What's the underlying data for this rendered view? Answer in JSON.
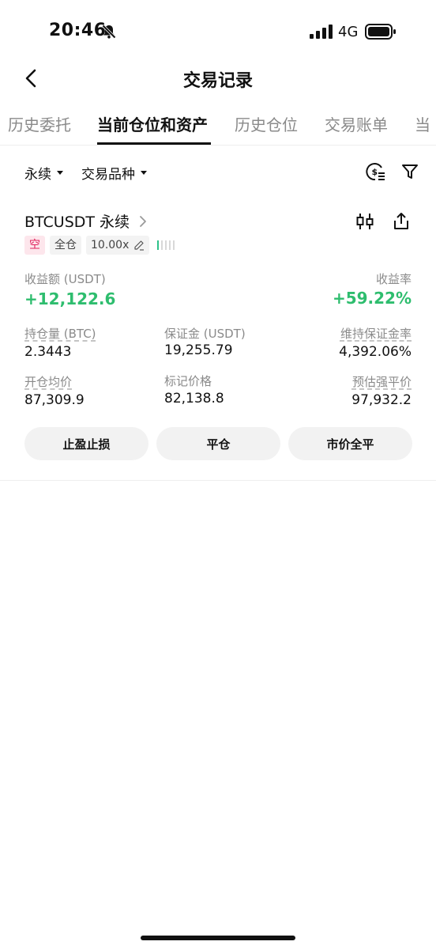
{
  "status_bar": {
    "time": "20:46",
    "network": "4G"
  },
  "nav": {
    "title": "交易记录"
  },
  "tabs": [
    {
      "label": "历史委托"
    },
    {
      "label": "当前仓位和资产"
    },
    {
      "label": "历史仓位"
    },
    {
      "label": "交易账单"
    },
    {
      "label": "当"
    }
  ],
  "filters": {
    "type": "永续",
    "product": "交易品种"
  },
  "position": {
    "pair": "BTCUSDT 永续",
    "side": "空",
    "margin_mode": "全仓",
    "leverage": "10.00x",
    "pnl_label": "收益额 (USDT)",
    "pnl_value": "+12,122.6",
    "roi_label": "收益率",
    "roi_value": "+59.22%",
    "size_label": "持仓量 (BTC)",
    "size_value": "2.3443",
    "margin_label": "保证金 (USDT)",
    "margin_value": "19,255.79",
    "mmr_label": "维持保证金率",
    "mmr_value": "4,392.06%",
    "entry_label": "开仓均价",
    "entry_value": "87,309.9",
    "mark_label": "标记价格",
    "mark_value": "82,138.8",
    "liq_label": "预估强平价",
    "liq_value": "97,932.2"
  },
  "actions": {
    "tp_sl": "止盈止损",
    "close": "平仓",
    "market_close_all": "市价全平"
  },
  "colors": {
    "profit": "#2ebd6e",
    "short": "#e0245e"
  }
}
